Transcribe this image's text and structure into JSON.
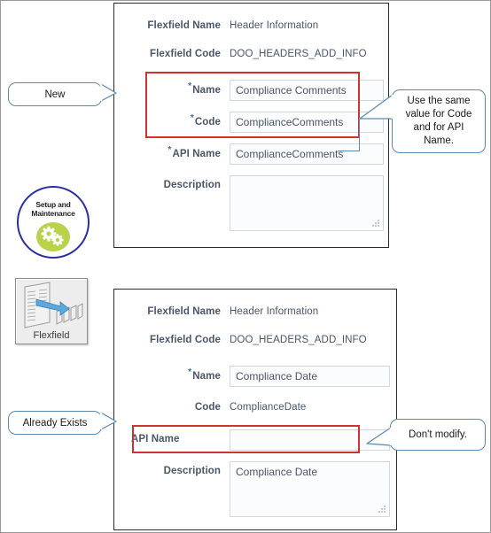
{
  "panels": {
    "top": {
      "flexfield_name_label": "Flexfield Name",
      "flexfield_name_value": "Header Information",
      "flexfield_code_label": "Flexfield Code",
      "flexfield_code_value": "DOO_HEADERS_ADD_INFO",
      "name_label": "Name",
      "name_value": "Compliance Comments",
      "code_label": "Code",
      "code_value": "ComplianceComments",
      "api_name_label": "API Name",
      "api_name_value": "ComplianceComments",
      "description_label": "Description",
      "description_value": ""
    },
    "bottom": {
      "flexfield_name_label": "Flexfield Name",
      "flexfield_name_value": "Header Information",
      "flexfield_code_label": "Flexfield Code",
      "flexfield_code_value": "DOO_HEADERS_ADD_INFO",
      "name_label": "Name",
      "name_value": "Compliance Date",
      "code_label": "Code",
      "code_value": "ComplianceDate",
      "api_name_label": "API Name",
      "api_name_value": "",
      "description_label": "Description",
      "description_value": "Compliance Date"
    }
  },
  "callouts": {
    "new": "New",
    "use_same_value": "Use the same value for Code and for API Name.",
    "already_exists": "Already Exists",
    "dont_modify": "Don't modify."
  },
  "icons": {
    "setup_maintenance_label": "Setup and Maintenance",
    "flexfield_label": "Flexfield"
  },
  "colors": {
    "highlight_red": "#d2322d",
    "callout_blue": "#5b87b5",
    "required_blue": "#2f6fb5",
    "label_gray": "#4a5568",
    "gear_green": "#b9d24b",
    "ring_blue": "#2a2fa5"
  }
}
